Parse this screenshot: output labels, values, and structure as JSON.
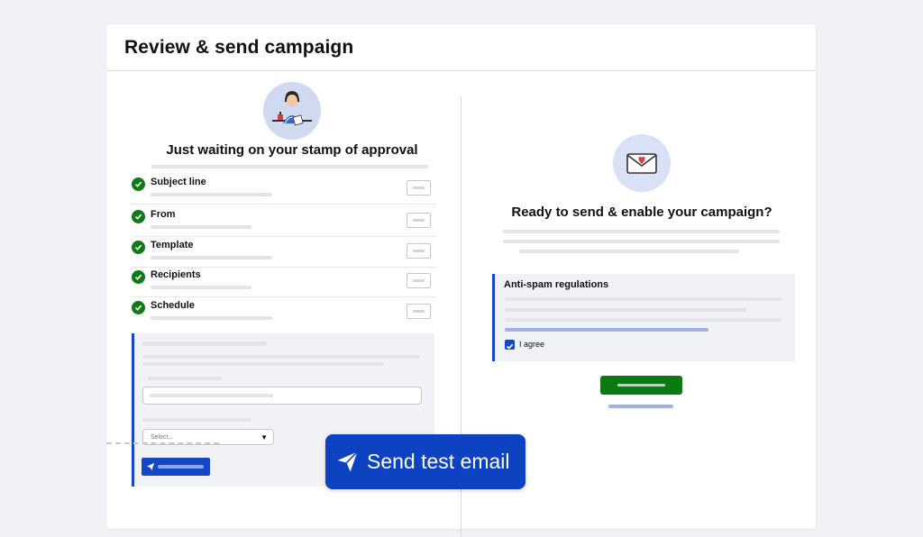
{
  "page": {
    "title": "Review & send campaign"
  },
  "left": {
    "heading": "Just waiting on your stamp of approval",
    "checklist": [
      {
        "label": "Subject line"
      },
      {
        "label": "From"
      },
      {
        "label": "Template"
      },
      {
        "label": "Recipients"
      },
      {
        "label": "Schedule"
      }
    ],
    "test_panel": {
      "select_placeholder": "Select..."
    },
    "send_test_button": "Send test email"
  },
  "right": {
    "heading": "Ready to send & enable your campaign?",
    "anti_spam": {
      "title": "Anti-spam regulations",
      "agree_label": "I agree",
      "agree_checked": true
    }
  },
  "colors": {
    "primary_blue": "#0d42c2",
    "success_green": "#0c7a13",
    "check_green": "#0f7a17",
    "panel_bg": "#f1f2f6"
  },
  "icons": {
    "check": "check-circle-icon",
    "send": "paper-plane-icon",
    "envelope": "envelope-heart-icon",
    "avatar": "woman-stamp-illustration"
  }
}
